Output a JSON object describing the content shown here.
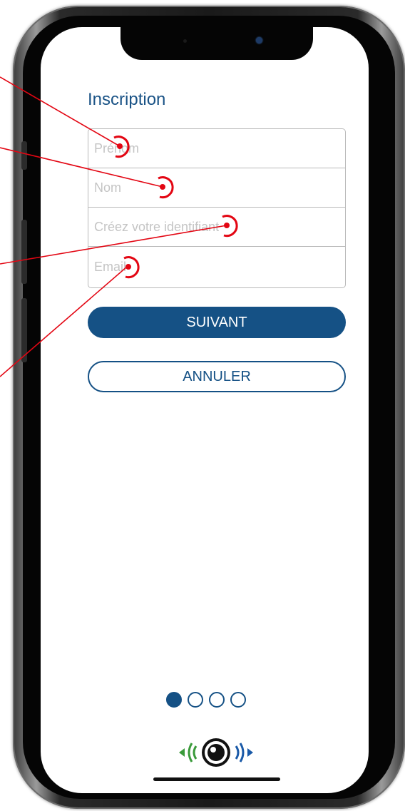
{
  "screen": {
    "title": "Inscription",
    "fields": [
      {
        "name": "prenom",
        "placeholder": "Prénom"
      },
      {
        "name": "nom",
        "placeholder": "Nom"
      },
      {
        "name": "identifiant",
        "placeholder": "Créez votre identifiant"
      },
      {
        "name": "email",
        "placeholder": "Email"
      }
    ],
    "next_label": "SUIVANT",
    "cancel_label": "ANNULER",
    "pagination": {
      "total": 4,
      "current": 1
    }
  },
  "colors": {
    "accent": "#155185",
    "annotation": "#e30613"
  },
  "icons": {
    "logo": "eye-with-sound-waves-logo"
  }
}
